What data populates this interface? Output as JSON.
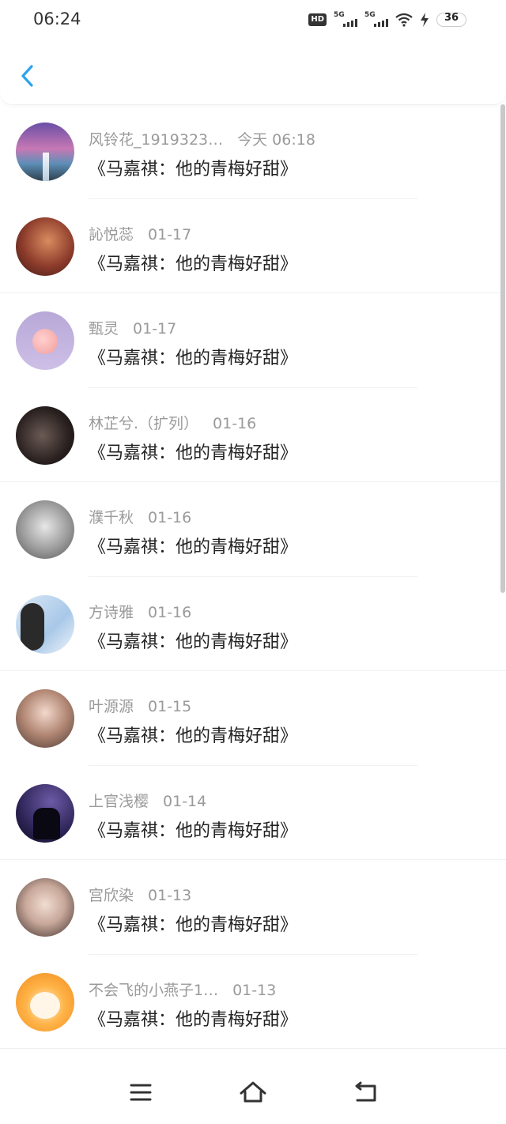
{
  "status_bar": {
    "time": "06:24",
    "network_hd": "HD",
    "sim1": "5G",
    "sim2": "5G",
    "battery": "36",
    "icons": [
      "hd-icon",
      "signal-icon",
      "signal-icon",
      "wifi-icon",
      "charging-icon",
      "battery-icon"
    ]
  },
  "header": {
    "back_icon": "chevron-left-icon"
  },
  "list": {
    "items": [
      {
        "name": "风铃花_1919323…",
        "date": "今天 06:18",
        "title": "《马嘉祺：他的青梅好甜》"
      },
      {
        "name": "訫悦蕊",
        "date": "01-17",
        "title": "《马嘉祺：他的青梅好甜》"
      },
      {
        "name": "甄灵",
        "date": "01-17",
        "title": "《马嘉祺：他的青梅好甜》"
      },
      {
        "name": "林芷兮.（扩列）",
        "date": "01-16",
        "title": "《马嘉祺：他的青梅好甜》"
      },
      {
        "name": "濮千秋",
        "date": "01-16",
        "title": "《马嘉祺：他的青梅好甜》"
      },
      {
        "name": "方诗雅",
        "date": "01-16",
        "title": "《马嘉祺：他的青梅好甜》"
      },
      {
        "name": "叶源源",
        "date": "01-15",
        "title": "《马嘉祺：他的青梅好甜》"
      },
      {
        "name": "上官浅樱",
        "date": "01-14",
        "title": "《马嘉祺：他的青梅好甜》"
      },
      {
        "name": "宫欣染",
        "date": "01-13",
        "title": "《马嘉祺：他的青梅好甜》"
      },
      {
        "name": "不会飞的小燕子1…",
        "date": "01-13",
        "title": "《马嘉祺：他的青梅好甜》"
      }
    ]
  },
  "navbar": {
    "icons": [
      "menu-icon",
      "home-icon",
      "back-icon"
    ]
  },
  "colors": {
    "accent": "#2aa3ef",
    "meta_text": "#9a9a9a",
    "title_text": "#222222"
  }
}
